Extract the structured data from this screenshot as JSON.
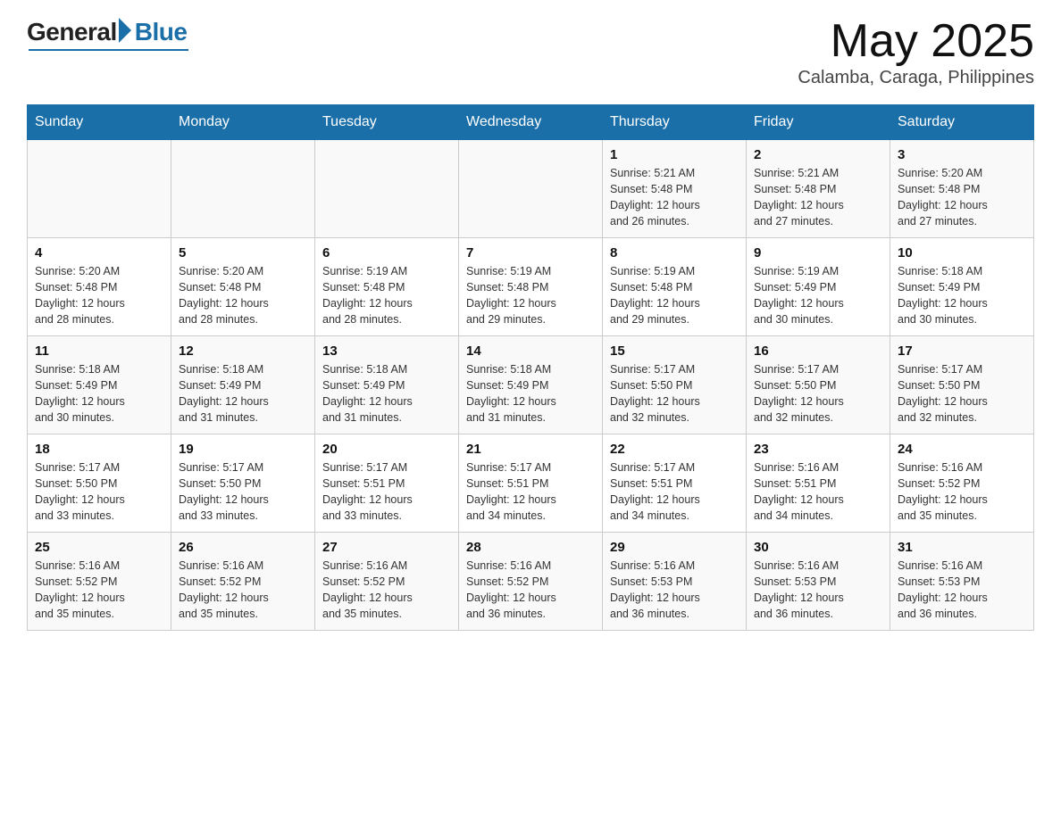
{
  "header": {
    "logo_general": "General",
    "logo_blue": "Blue",
    "logo_subtitle": "Blue",
    "month_year": "May 2025",
    "location": "Calamba, Caraga, Philippines"
  },
  "days_of_week": [
    "Sunday",
    "Monday",
    "Tuesday",
    "Wednesday",
    "Thursday",
    "Friday",
    "Saturday"
  ],
  "weeks": [
    {
      "days": [
        {
          "num": "",
          "info": ""
        },
        {
          "num": "",
          "info": ""
        },
        {
          "num": "",
          "info": ""
        },
        {
          "num": "",
          "info": ""
        },
        {
          "num": "1",
          "info": "Sunrise: 5:21 AM\nSunset: 5:48 PM\nDaylight: 12 hours\nand 26 minutes."
        },
        {
          "num": "2",
          "info": "Sunrise: 5:21 AM\nSunset: 5:48 PM\nDaylight: 12 hours\nand 27 minutes."
        },
        {
          "num": "3",
          "info": "Sunrise: 5:20 AM\nSunset: 5:48 PM\nDaylight: 12 hours\nand 27 minutes."
        }
      ]
    },
    {
      "days": [
        {
          "num": "4",
          "info": "Sunrise: 5:20 AM\nSunset: 5:48 PM\nDaylight: 12 hours\nand 28 minutes."
        },
        {
          "num": "5",
          "info": "Sunrise: 5:20 AM\nSunset: 5:48 PM\nDaylight: 12 hours\nand 28 minutes."
        },
        {
          "num": "6",
          "info": "Sunrise: 5:19 AM\nSunset: 5:48 PM\nDaylight: 12 hours\nand 28 minutes."
        },
        {
          "num": "7",
          "info": "Sunrise: 5:19 AM\nSunset: 5:48 PM\nDaylight: 12 hours\nand 29 minutes."
        },
        {
          "num": "8",
          "info": "Sunrise: 5:19 AM\nSunset: 5:48 PM\nDaylight: 12 hours\nand 29 minutes."
        },
        {
          "num": "9",
          "info": "Sunrise: 5:19 AM\nSunset: 5:49 PM\nDaylight: 12 hours\nand 30 minutes."
        },
        {
          "num": "10",
          "info": "Sunrise: 5:18 AM\nSunset: 5:49 PM\nDaylight: 12 hours\nand 30 minutes."
        }
      ]
    },
    {
      "days": [
        {
          "num": "11",
          "info": "Sunrise: 5:18 AM\nSunset: 5:49 PM\nDaylight: 12 hours\nand 30 minutes."
        },
        {
          "num": "12",
          "info": "Sunrise: 5:18 AM\nSunset: 5:49 PM\nDaylight: 12 hours\nand 31 minutes."
        },
        {
          "num": "13",
          "info": "Sunrise: 5:18 AM\nSunset: 5:49 PM\nDaylight: 12 hours\nand 31 minutes."
        },
        {
          "num": "14",
          "info": "Sunrise: 5:18 AM\nSunset: 5:49 PM\nDaylight: 12 hours\nand 31 minutes."
        },
        {
          "num": "15",
          "info": "Sunrise: 5:17 AM\nSunset: 5:50 PM\nDaylight: 12 hours\nand 32 minutes."
        },
        {
          "num": "16",
          "info": "Sunrise: 5:17 AM\nSunset: 5:50 PM\nDaylight: 12 hours\nand 32 minutes."
        },
        {
          "num": "17",
          "info": "Sunrise: 5:17 AM\nSunset: 5:50 PM\nDaylight: 12 hours\nand 32 minutes."
        }
      ]
    },
    {
      "days": [
        {
          "num": "18",
          "info": "Sunrise: 5:17 AM\nSunset: 5:50 PM\nDaylight: 12 hours\nand 33 minutes."
        },
        {
          "num": "19",
          "info": "Sunrise: 5:17 AM\nSunset: 5:50 PM\nDaylight: 12 hours\nand 33 minutes."
        },
        {
          "num": "20",
          "info": "Sunrise: 5:17 AM\nSunset: 5:51 PM\nDaylight: 12 hours\nand 33 minutes."
        },
        {
          "num": "21",
          "info": "Sunrise: 5:17 AM\nSunset: 5:51 PM\nDaylight: 12 hours\nand 34 minutes."
        },
        {
          "num": "22",
          "info": "Sunrise: 5:17 AM\nSunset: 5:51 PM\nDaylight: 12 hours\nand 34 minutes."
        },
        {
          "num": "23",
          "info": "Sunrise: 5:16 AM\nSunset: 5:51 PM\nDaylight: 12 hours\nand 34 minutes."
        },
        {
          "num": "24",
          "info": "Sunrise: 5:16 AM\nSunset: 5:52 PM\nDaylight: 12 hours\nand 35 minutes."
        }
      ]
    },
    {
      "days": [
        {
          "num": "25",
          "info": "Sunrise: 5:16 AM\nSunset: 5:52 PM\nDaylight: 12 hours\nand 35 minutes."
        },
        {
          "num": "26",
          "info": "Sunrise: 5:16 AM\nSunset: 5:52 PM\nDaylight: 12 hours\nand 35 minutes."
        },
        {
          "num": "27",
          "info": "Sunrise: 5:16 AM\nSunset: 5:52 PM\nDaylight: 12 hours\nand 35 minutes."
        },
        {
          "num": "28",
          "info": "Sunrise: 5:16 AM\nSunset: 5:52 PM\nDaylight: 12 hours\nand 36 minutes."
        },
        {
          "num": "29",
          "info": "Sunrise: 5:16 AM\nSunset: 5:53 PM\nDaylight: 12 hours\nand 36 minutes."
        },
        {
          "num": "30",
          "info": "Sunrise: 5:16 AM\nSunset: 5:53 PM\nDaylight: 12 hours\nand 36 minutes."
        },
        {
          "num": "31",
          "info": "Sunrise: 5:16 AM\nSunset: 5:53 PM\nDaylight: 12 hours\nand 36 minutes."
        }
      ]
    }
  ]
}
